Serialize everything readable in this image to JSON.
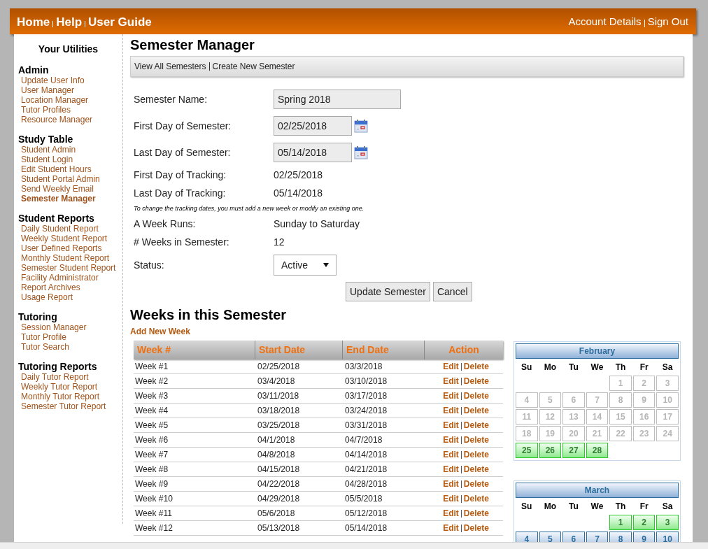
{
  "header": {
    "nav_left": [
      "Home",
      "Help",
      "User Guide"
    ],
    "nav_right": [
      "Account Details",
      "Sign Out"
    ]
  },
  "sidebar": {
    "title": "Your Utilities",
    "sections": [
      {
        "title": "Admin",
        "items": [
          {
            "label": "Update User Info",
            "selected": false
          },
          {
            "label": "User Manager",
            "selected": false
          },
          {
            "label": "Location Manager",
            "selected": false
          },
          {
            "label": "Tutor Profiles",
            "selected": false
          },
          {
            "label": "Resource Manager",
            "selected": false
          }
        ]
      },
      {
        "title": "Study Table",
        "items": [
          {
            "label": "Student Admin",
            "selected": false
          },
          {
            "label": "Student Login",
            "selected": false
          },
          {
            "label": "Edit Student Hours",
            "selected": false
          },
          {
            "label": "Student Portal Admin",
            "selected": false
          },
          {
            "label": "Send Weekly Email",
            "selected": false
          },
          {
            "label": "Semester Manager",
            "selected": true
          }
        ]
      },
      {
        "title": "Student Reports",
        "items": [
          {
            "label": "Daily Student Report",
            "selected": false
          },
          {
            "label": "Weekly Student Report",
            "selected": false
          },
          {
            "label": "User Defined Reports",
            "selected": false
          },
          {
            "label": "Monthly Student Report",
            "selected": false
          },
          {
            "label": "Semester Student Report",
            "selected": false
          },
          {
            "label": "Facility Administrator",
            "selected": false
          },
          {
            "label": "Report Archives",
            "selected": false
          },
          {
            "label": "Usage Report",
            "selected": false
          }
        ]
      },
      {
        "title": "Tutoring",
        "items": [
          {
            "label": "Session Manager",
            "selected": false
          },
          {
            "label": "Tutor Profile",
            "selected": false
          },
          {
            "label": "Tutor Search",
            "selected": false
          }
        ]
      },
      {
        "title": "Tutoring Reports",
        "items": [
          {
            "label": "Daily Tutor Report",
            "selected": false
          },
          {
            "label": "Weekly Tutor Report",
            "selected": false
          },
          {
            "label": "Monthly Tutor Report",
            "selected": false
          },
          {
            "label": "Semester Tutor Report",
            "selected": false
          }
        ]
      }
    ]
  },
  "page_title": "Semester Manager",
  "toolbar_links": [
    "View All Semesters",
    "Create New Semester"
  ],
  "form": [
    {
      "kind": "text",
      "label": "Semester Name:",
      "value": "Spring 2018"
    },
    {
      "kind": "date",
      "label": "First Day of Semester:",
      "value": "02/25/2018"
    },
    {
      "kind": "date",
      "label": "Last Day of Semester:",
      "value": "05/14/2018"
    },
    {
      "kind": "static",
      "label": "First Day of Tracking:",
      "value": "02/25/2018"
    },
    {
      "kind": "static",
      "label": "Last Day of Tracking:",
      "value": "05/14/2018"
    },
    {
      "kind": "note",
      "text": "To change the tracking dates, you must add a new week or modify an existing one."
    },
    {
      "kind": "static",
      "label": "A Week Runs:",
      "value": "Sunday to Saturday"
    },
    {
      "kind": "static",
      "label": "# Weeks in Semester:",
      "value": "12"
    },
    {
      "kind": "select",
      "label": "Status:",
      "value": "Active"
    }
  ],
  "buttons": [
    "Update Semester",
    "Cancel"
  ],
  "weeks_title": "Weeks in this Semester",
  "add_week_link": "Add New Week",
  "table": {
    "columns": [
      "Week #",
      "Start Date",
      "End Date",
      "Action"
    ],
    "rows": [
      {
        "cells": [
          "Week #1",
          "02/25/2018",
          "03/3/2018"
        ],
        "actions": [
          "Edit",
          "Delete"
        ]
      },
      {
        "cells": [
          "Week #2",
          "03/4/2018",
          "03/10/2018"
        ],
        "actions": [
          "Edit",
          "Delete"
        ]
      },
      {
        "cells": [
          "Week #3",
          "03/11/2018",
          "03/17/2018"
        ],
        "actions": [
          "Edit",
          "Delete"
        ]
      },
      {
        "cells": [
          "Week #4",
          "03/18/2018",
          "03/24/2018"
        ],
        "actions": [
          "Edit",
          "Delete"
        ]
      },
      {
        "cells": [
          "Week #5",
          "03/25/2018",
          "03/31/2018"
        ],
        "actions": [
          "Edit",
          "Delete"
        ]
      },
      {
        "cells": [
          "Week #6",
          "04/1/2018",
          "04/7/2018"
        ],
        "actions": [
          "Edit",
          "Delete"
        ]
      },
      {
        "cells": [
          "Week #7",
          "04/8/2018",
          "04/14/2018"
        ],
        "actions": [
          "Edit",
          "Delete"
        ]
      },
      {
        "cells": [
          "Week #8",
          "04/15/2018",
          "04/21/2018"
        ],
        "actions": [
          "Edit",
          "Delete"
        ]
      },
      {
        "cells": [
          "Week #9",
          "04/22/2018",
          "04/28/2018"
        ],
        "actions": [
          "Edit",
          "Delete"
        ]
      },
      {
        "cells": [
          "Week #10",
          "04/29/2018",
          "05/5/2018"
        ],
        "actions": [
          "Edit",
          "Delete"
        ]
      },
      {
        "cells": [
          "Week #11",
          "05/6/2018",
          "05/12/2018"
        ],
        "actions": [
          "Edit",
          "Delete"
        ]
      },
      {
        "cells": [
          "Week #12",
          "05/13/2018",
          "05/14/2018"
        ],
        "actions": [
          "Edit",
          "Delete"
        ]
      }
    ]
  },
  "calendars": [
    {
      "month": "February",
      "weekdays": [
        "Su",
        "Mo",
        "Tu",
        "We",
        "Th",
        "Fr",
        "Sa"
      ],
      "weeks": [
        {
          "midweek_start": true,
          "days": [
            {
              "day": "1",
              "kind": "outside"
            },
            {
              "day": "2",
              "kind": "outside"
            },
            {
              "day": "3",
              "kind": "outside"
            }
          ]
        },
        {
          "days": [
            {
              "day": "4",
              "kind": "outside"
            },
            {
              "day": "5",
              "kind": "outside"
            },
            {
              "day": "6",
              "kind": "outside"
            },
            {
              "day": "7",
              "kind": "outside"
            },
            {
              "day": "8",
              "kind": "outside"
            },
            {
              "day": "9",
              "kind": "outside"
            },
            {
              "day": "10",
              "kind": "outside"
            }
          ]
        },
        {
          "days": [
            {
              "day": "11",
              "kind": "outside"
            },
            {
              "day": "12",
              "kind": "outside"
            },
            {
              "day": "13",
              "kind": "outside"
            },
            {
              "day": "14",
              "kind": "outside"
            },
            {
              "day": "15",
              "kind": "outside"
            },
            {
              "day": "16",
              "kind": "outside"
            },
            {
              "day": "17",
              "kind": "outside"
            }
          ]
        },
        {
          "days": [
            {
              "day": "18",
              "kind": "outside"
            },
            {
              "day": "19",
              "kind": "outside"
            },
            {
              "day": "20",
              "kind": "outside"
            },
            {
              "day": "21",
              "kind": "outside"
            },
            {
              "day": "22",
              "kind": "outside"
            },
            {
              "day": "23",
              "kind": "outside"
            },
            {
              "day": "24",
              "kind": "outside"
            }
          ]
        },
        {
          "midweek_start": false,
          "days": [
            {
              "day": "25",
              "kind": "highlighted"
            },
            {
              "day": "26",
              "kind": "highlighted"
            },
            {
              "day": "27",
              "kind": "highlighted"
            },
            {
              "day": "28",
              "kind": "highlighted"
            }
          ]
        }
      ]
    },
    {
      "month": "March",
      "weekdays": [
        "Su",
        "Mo",
        "Tu",
        "We",
        "Th",
        "Fr",
        "Sa"
      ],
      "weeks": [
        {
          "midweek_start": true,
          "days": [
            {
              "day": "1",
              "kind": "highlighted"
            },
            {
              "day": "2",
              "kind": "highlighted"
            },
            {
              "day": "3",
              "kind": "highlighted"
            }
          ]
        },
        {
          "days": [
            {
              "day": "4",
              "kind": "normal"
            },
            {
              "day": "5",
              "kind": "normal"
            },
            {
              "day": "6",
              "kind": "normal"
            },
            {
              "day": "7",
              "kind": "normal"
            },
            {
              "day": "8",
              "kind": "normal"
            },
            {
              "day": "9",
              "kind": "normal"
            },
            {
              "day": "10",
              "kind": "normal"
            }
          ]
        }
      ]
    }
  ]
}
